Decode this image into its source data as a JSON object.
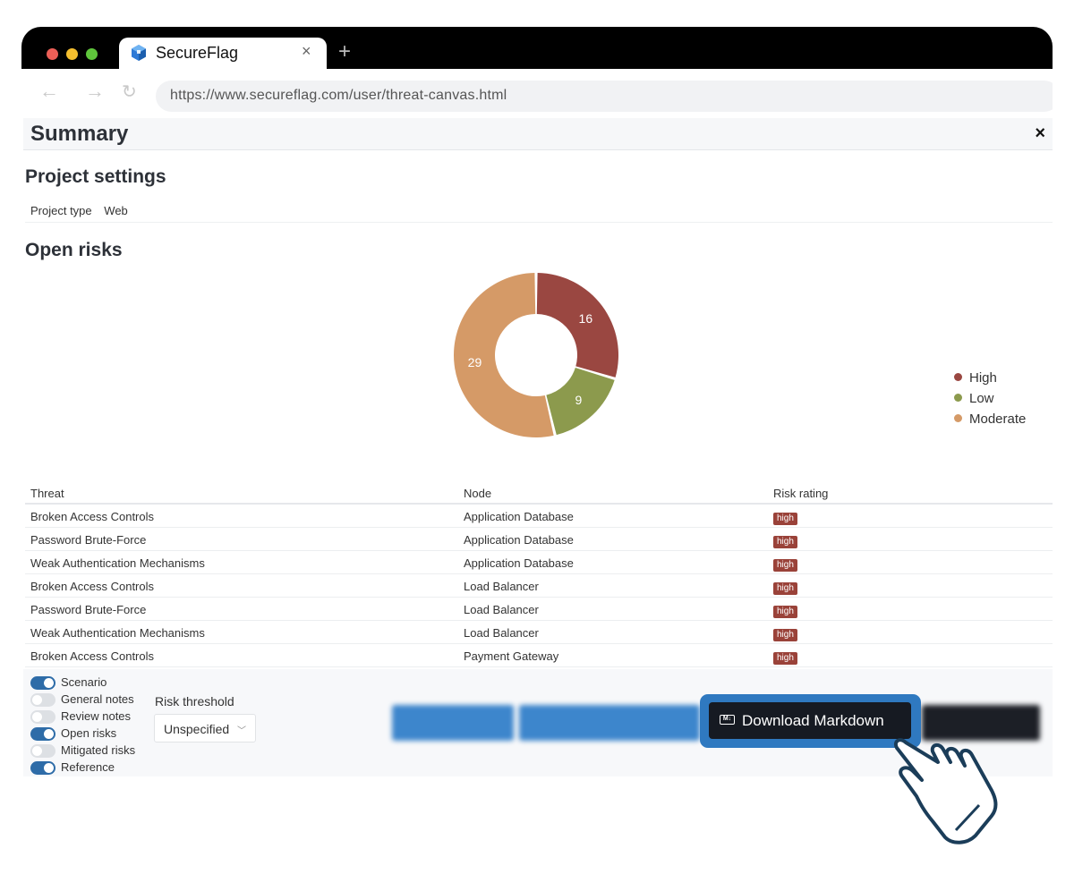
{
  "browser": {
    "tab_title": "SecureFlag",
    "tab_close": "×",
    "new_tab": "+",
    "url": "https://www.secureflag.com/user/threat-canvas.html",
    "traffic_lights": [
      "#ec5f57",
      "#f5bf2f",
      "#5fc63c"
    ]
  },
  "summary": {
    "title": "Summary",
    "close": "×"
  },
  "project_settings": {
    "heading": "Project settings",
    "type_label": "Project type",
    "type_value": "Web"
  },
  "open_risks": {
    "heading": "Open risks"
  },
  "chart_data": {
    "type": "pie",
    "donut": true,
    "categories": [
      "High",
      "Low",
      "Moderate"
    ],
    "values": [
      16,
      9,
      29
    ],
    "colors": [
      "#9a4741",
      "#8c9a4d",
      "#d59a67"
    ],
    "legend_position": "right"
  },
  "table": {
    "headers": [
      "Threat",
      "Node",
      "Risk rating"
    ],
    "rows": [
      {
        "threat": "Broken Access Controls",
        "node": "Application Database",
        "rating": "high"
      },
      {
        "threat": "Password Brute-Force",
        "node": "Application Database",
        "rating": "high"
      },
      {
        "threat": "Weak Authentication Mechanisms",
        "node": "Application Database",
        "rating": "high"
      },
      {
        "threat": "Broken Access Controls",
        "node": "Load Balancer",
        "rating": "high"
      },
      {
        "threat": "Password Brute-Force",
        "node": "Load Balancer",
        "rating": "high"
      },
      {
        "threat": "Weak Authentication Mechanisms",
        "node": "Load Balancer",
        "rating": "high"
      },
      {
        "threat": "Broken Access Controls",
        "node": "Payment Gateway",
        "rating": "high"
      }
    ]
  },
  "toggles": [
    {
      "label": "Scenario",
      "on": true
    },
    {
      "label": "General notes",
      "on": false
    },
    {
      "label": "Review notes",
      "on": false
    },
    {
      "label": "Open risks",
      "on": true
    },
    {
      "label": "Mitigated risks",
      "on": false
    },
    {
      "label": "Reference",
      "on": true
    }
  ],
  "risk_threshold": {
    "label": "Risk threshold",
    "value": "Unspecified"
  },
  "actions": {
    "download_markdown": "Download Markdown",
    "markdown_icon": "M↓"
  },
  "colors": {
    "accent": "#2f79c0",
    "high_badge": "#9a4239",
    "dark_button": "#161a22"
  }
}
